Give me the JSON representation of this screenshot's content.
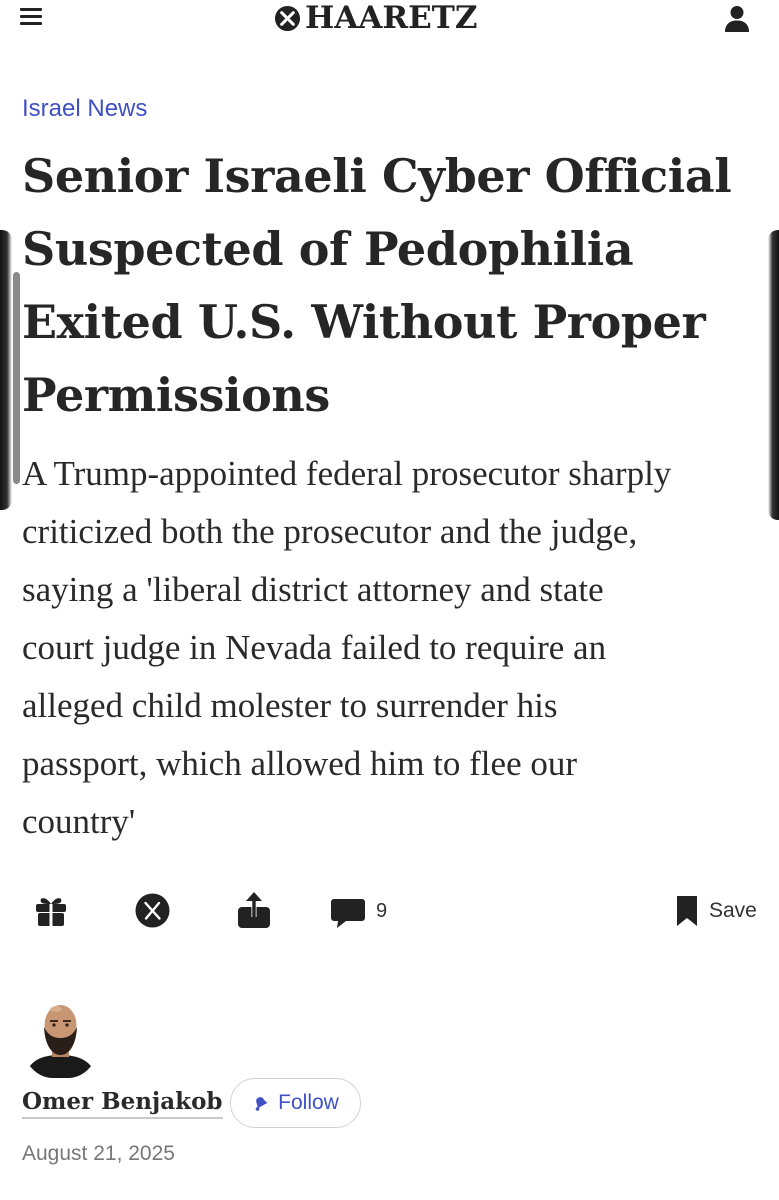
{
  "header": {
    "logo_text": "HAARETZ",
    "menu_icon": "hamburger-menu-icon",
    "user_icon": "user-account-icon"
  },
  "article": {
    "section": "Israel News",
    "headline_lines": [
      "Senior Israeli Cyber Official",
      "Suspected of Pedophilia",
      "Exited U.S. Without Proper",
      "Permissions"
    ],
    "subhead_lines": [
      "A Trump-appointed federal prosecutor sharply",
      "criticized both the prosecutor and the judge,",
      "saying a 'liberal district attorney and state",
      "court judge in Nevada failed to require an",
      "alleged child molester to surrender his",
      "passport, which allowed him to flee our",
      "country'"
    ]
  },
  "actions": {
    "gift_icon": "gift-icon",
    "x_icon": "x-share-icon",
    "share_icon": "share-icon",
    "comment_icon": "comment-icon",
    "comment_count": "9",
    "save_icon": "bookmark-icon",
    "save_label": "Save"
  },
  "author": {
    "name": "Omer Benjakob",
    "follow_label": "Follow",
    "date": "August 21, 2025"
  },
  "colors": {
    "accent": "#3f51c4",
    "text": "#262626",
    "muted": "#777777"
  }
}
